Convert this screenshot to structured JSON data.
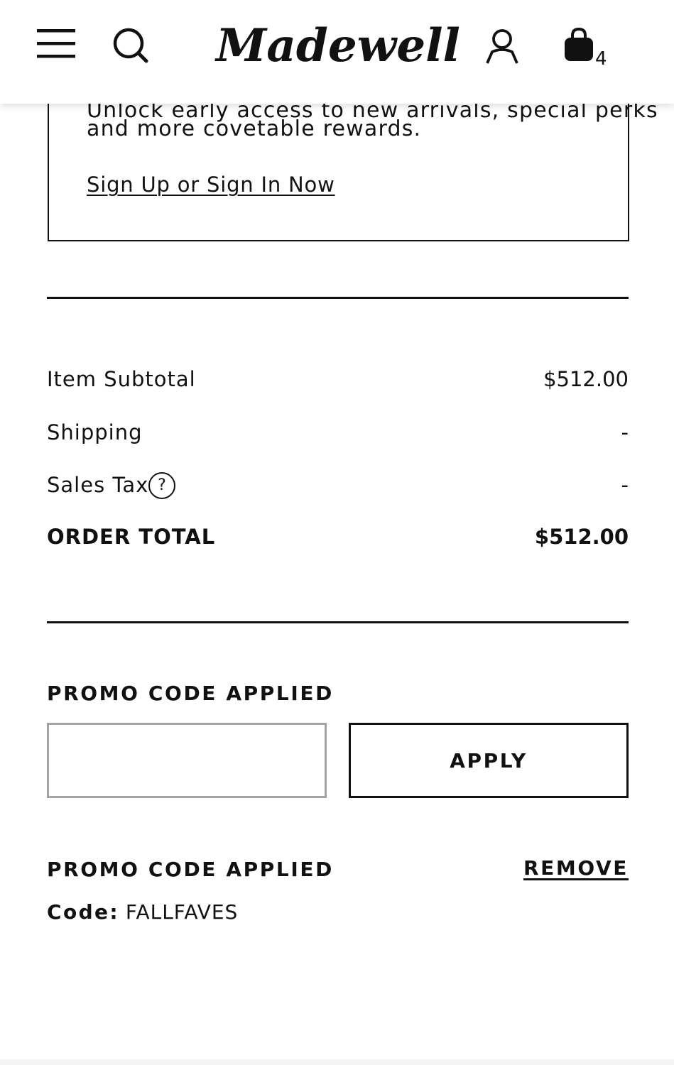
{
  "header": {
    "logo_text": "Madewell",
    "bag_count": "4",
    "icons": [
      "hamburger-menu-icon",
      "search-icon",
      "account-icon",
      "shopping-bag-icon"
    ]
  },
  "rewards": {
    "partial_line": "Unlock early access to new arrivals, special perks",
    "text": "and more covetable rewards.",
    "link_label": "Sign Up or Sign In Now"
  },
  "summary": {
    "subtotal_label": "Item Subtotal",
    "subtotal_value": "$512.00",
    "shipping_label": "Shipping",
    "shipping_value": "-",
    "tax_label": "Sales Tax",
    "tax_help": "?",
    "tax_value": "-",
    "total_label": "ORDER TOTAL",
    "total_value": "$512.00"
  },
  "promo": {
    "heading": "PROMO CODE APPLIED",
    "input_value": "",
    "input_placeholder": "",
    "apply_label": "APPLY",
    "applied_heading": "PROMO CODE APPLIED",
    "remove_label": "REMOVE",
    "code_label": "Code:",
    "code_value": "FALLFAVES"
  },
  "colors": {
    "text": "#111111",
    "background": "#ffffff",
    "input_border": "#a3a3a3"
  }
}
